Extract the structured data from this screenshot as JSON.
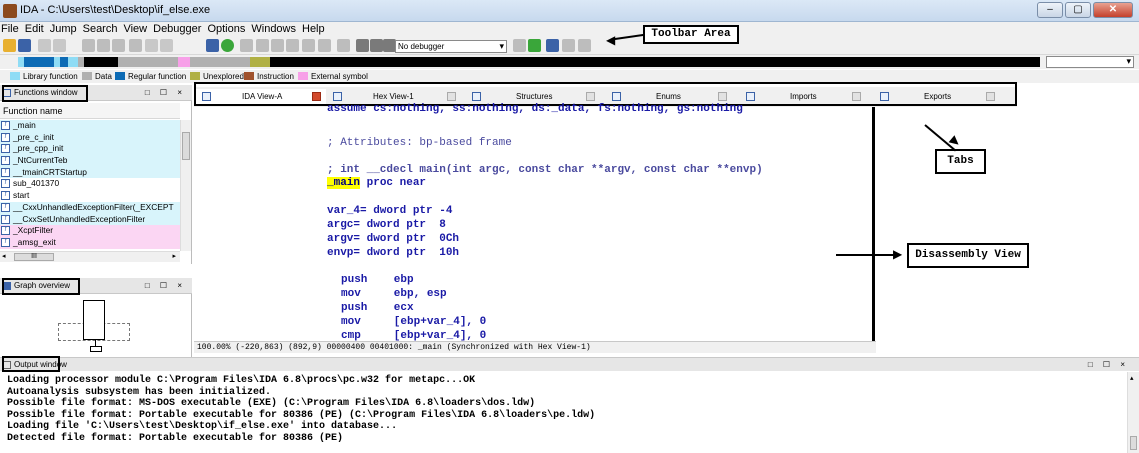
{
  "window": {
    "title": "IDA - C:\\Users\\test\\Desktop\\if_else.exe",
    "buttons": [
      "–",
      "▢",
      "✕"
    ]
  },
  "menu": [
    "File",
    "Edit",
    "Jump",
    "Search",
    "View",
    "Debugger",
    "Options",
    "Windows",
    "Help"
  ],
  "toolbar": {
    "debugger_label": "No debugger"
  },
  "legend": [
    {
      "label": "Library function",
      "color": "#8fdcf5"
    },
    {
      "label": "Data",
      "color": "#b0b0b0"
    },
    {
      "label": "Regular function",
      "color": "#0d6bb5"
    },
    {
      "label": "Unexplored",
      "color": "#b0b044"
    },
    {
      "label": "Instruction",
      "color": "#a0522d"
    },
    {
      "label": "External symbol",
      "color": "#f7a0e8"
    }
  ],
  "functions_panel": {
    "title": "Functions window",
    "buttons": "□ ☐ ×",
    "column": "Function name",
    "items": [
      {
        "name": "_main",
        "bg": "#d8f4fb"
      },
      {
        "name": "_pre_c_init",
        "bg": "#d8f4fb"
      },
      {
        "name": "_pre_cpp_init",
        "bg": "#d8f4fb"
      },
      {
        "name": "_NtCurrentTeb",
        "bg": "#d8f4fb"
      },
      {
        "name": "__tmainCRTStartup",
        "bg": "#d8f4fb"
      },
      {
        "name": "sub_401370",
        "bg": "#ffffff"
      },
      {
        "name": "start",
        "bg": "#ffffff"
      },
      {
        "name": "__CxxUnhandledExceptionFilter(_EXCEPT",
        "bg": "#d8f4fb"
      },
      {
        "name": "__CxxSetUnhandledExceptionFilter",
        "bg": "#d8f4fb"
      },
      {
        "name": "_XcptFilter",
        "bg": "#fbd6f3"
      },
      {
        "name": "_amsg_exit",
        "bg": "#fbd6f3"
      }
    ],
    "hscroll_thumb": "III"
  },
  "graph_panel": {
    "title": "Graph overview",
    "buttons": "□ ☐ ×"
  },
  "tabs": [
    {
      "label": "IDA View-A",
      "active": true
    },
    {
      "label": "Hex View-1",
      "active": false
    },
    {
      "label": "Structures",
      "active": false
    },
    {
      "label": "Enums",
      "active": false
    },
    {
      "label": "Imports",
      "active": false
    },
    {
      "label": "Exports",
      "active": false
    }
  ],
  "disassembly": {
    "cutoff_line": "assume cs:nothing, ss:nothing, ds:_data, fs:nothing, gs:nothing",
    "attributes": "; Attributes: bp-based frame",
    "signature": "; int __cdecl main(int argc, const char **argv, const char **envp)",
    "proc_name": "_main",
    "proc_rest": " proc near",
    "vars": [
      "var_4= dword ptr -4",
      "argc= dword ptr  8",
      "argv= dword ptr  0Ch",
      "envp= dword ptr  10h"
    ],
    "instructions": [
      "push    ebp",
      "mov     ebp, esp",
      "push    ecx",
      "mov     [ebp+var_4], 0",
      "cmp     [ebp+var_4], 0"
    ]
  },
  "status_line": "100.00% (-220,863) (892,9) 00000400 00401000: _main (Synchronized with Hex View-1)",
  "output_panel": {
    "title": "Output window",
    "buttons": "□ ☐ ×",
    "lines": [
      "Loading processor module C:\\Program Files\\IDA 6.8\\procs\\pc.w32 for metapc...OK",
      "Autoanalysis subsystem has been initialized.",
      "Possible file format: MS-DOS executable (EXE) (C:\\Program Files\\IDA 6.8\\loaders\\dos.ldw)",
      "Possible file format: Portable executable for 80386 (PE) (C:\\Program Files\\IDA 6.8\\loaders\\pe.ldw)",
      "Loading file 'C:\\Users\\test\\Desktop\\if_else.exe' into database...",
      "Detected file format: Portable executable for 80386 (PE)"
    ]
  },
  "annotations": {
    "toolbar_area": "Toolbar Area",
    "tabs": "Tabs",
    "disassembly_view": "Disassembly View"
  }
}
